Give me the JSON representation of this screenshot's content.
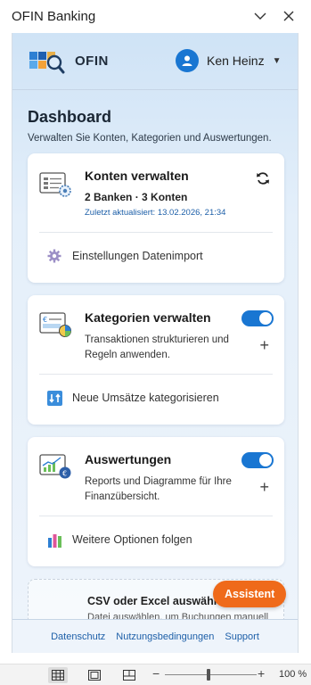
{
  "window": {
    "title": "OFIN Banking"
  },
  "header": {
    "brand": "OFIN",
    "user_name": "Ken Heinz"
  },
  "dashboard": {
    "title": "Dashboard",
    "subtitle": "Verwalten Sie Konten, Kategorien und Auswertungen."
  },
  "cards": {
    "accounts": {
      "title": "Konten verwalten",
      "summary": "2 Banken · 3 Konten",
      "updated": "Zuletzt aktualisiert: 13.02.2026, 21:34",
      "footer_label": "Einstellungen Datenimport"
    },
    "categories": {
      "title": "Kategorien verwalten",
      "desc": "Transaktionen strukturieren und Regeln anwenden.",
      "toggle_on": true,
      "footer_label": "Neue Umsätze kategorisieren"
    },
    "reports": {
      "title": "Auswertungen",
      "desc": "Reports und Diagramme für Ihre Finanzübersicht.",
      "toggle_on": true,
      "footer_label": "Weitere Optionen folgen"
    }
  },
  "dropzone": {
    "title": "CSV oder Excel auswählen",
    "subtitle": "Datei auswählen, um Buchungen manuell"
  },
  "assistant": {
    "label": "Assistent"
  },
  "footer": {
    "links": [
      "Datenschutz",
      "Nutzungsbedingungen",
      "Support"
    ]
  },
  "statusbar": {
    "zoom": "100 %",
    "zoom_fraction": 0.5
  },
  "colors": {
    "accent": "#1976d2",
    "assistant": "#ef6a1a",
    "link": "#1d5fa8"
  },
  "icons": [
    "chevron-down-icon",
    "close-icon",
    "user-icon",
    "refresh-icon",
    "gear-icon",
    "categorize-icon",
    "chart-icon"
  ]
}
